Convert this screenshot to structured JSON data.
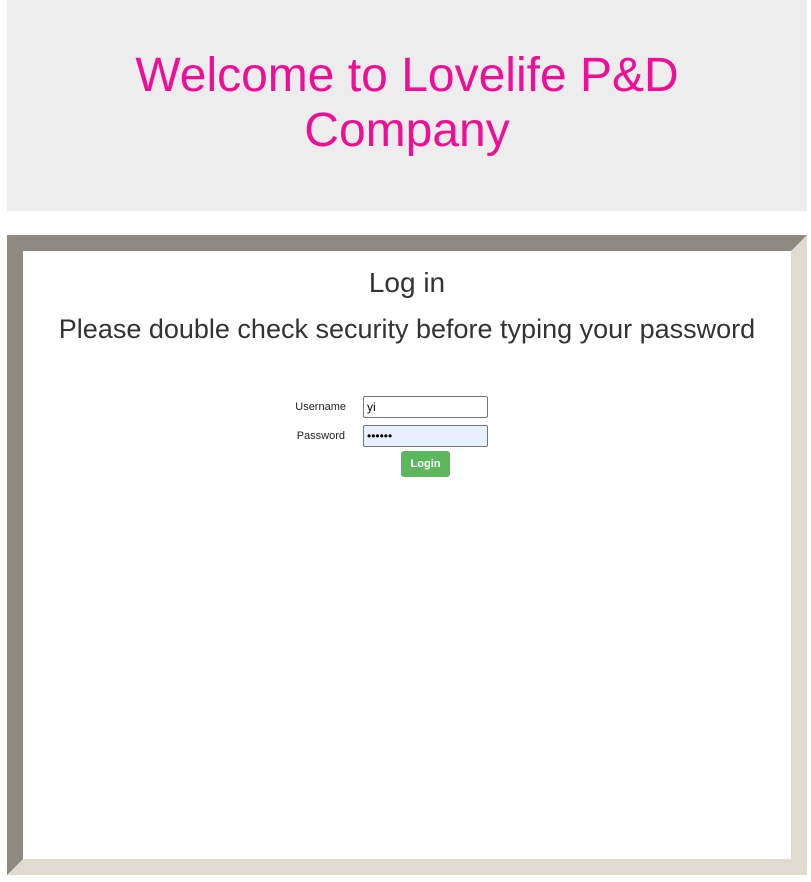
{
  "header": {
    "title": "Welcome to Lovelife P&D Company",
    "title_color": "#ee0f96",
    "background_color": "#ededed"
  },
  "login": {
    "heading": "Log in",
    "notice": "Please double check security before typing your password",
    "username_label": "Username",
    "username_value": "yi",
    "password_label": "Password",
    "password_value": "••••••",
    "button_label": "Login",
    "button_color": "#5cb85c"
  }
}
